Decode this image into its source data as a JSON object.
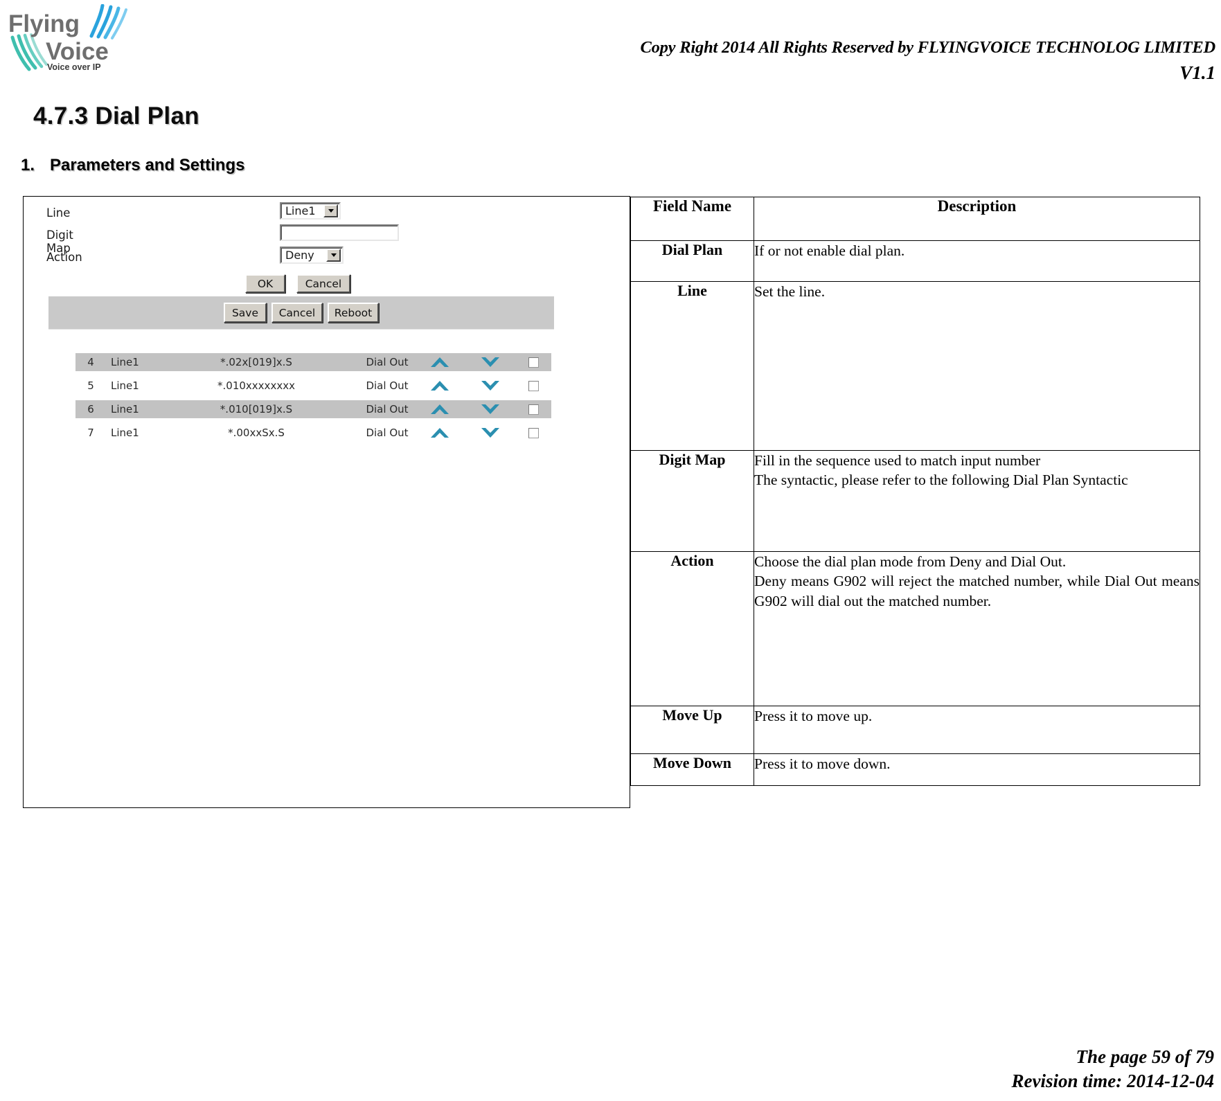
{
  "header": {
    "copyright": "Copy Right 2014 All Rights Reserved by FLYINGVOICE TECHNOLOG LIMITED",
    "version": "V1.1",
    "logo": {
      "line1": "Flying",
      "line2": "Voice",
      "tagline": "Voice over IP",
      "arc_color_blue": "#2aa3dd",
      "arc_color_teal": "#3fbfae",
      "text_color": "#6e6e6e"
    }
  },
  "headings": {
    "section": "4.7.3 Dial Plan",
    "subsection_number": "1.",
    "subsection_title": "Parameters and Settings"
  },
  "router_ui": {
    "fields": {
      "line_label": "Line",
      "line_value": "Line1",
      "digitmap_label": "Digit Map",
      "digitmap_value": "",
      "digitmap_placeholder": "",
      "action_label": "Action",
      "action_value": "Deny"
    },
    "form_buttons": {
      "ok": "OK",
      "cancel": "Cancel"
    },
    "action_bar": {
      "save": "Save",
      "cancel": "Cancel",
      "reboot": "Reboot"
    },
    "list_rows": [
      {
        "index": "4",
        "line": "Line1",
        "digits": "*.02x[019]x.S",
        "action": "Dial Out",
        "selected": true,
        "checked": false
      },
      {
        "index": "5",
        "line": "Line1",
        "digits": "*.010xxxxxxxx",
        "action": "Dial Out",
        "selected": false,
        "checked": false
      },
      {
        "index": "6",
        "line": "Line1",
        "digits": "*.010[019]x.S",
        "action": "Dial Out",
        "selected": true,
        "checked": false
      },
      {
        "index": "7",
        "line": "Line1",
        "digits": "*.00xxSx.S",
        "action": "Dial Out",
        "selected": false,
        "checked": false
      }
    ],
    "icons": {
      "move_up": "chevron-up-icon",
      "move_down": "chevron-down-icon",
      "select_row": "checkbox-icon"
    },
    "colors": {
      "chevron": "#2b8fb0",
      "toolbar_bg": "#c9c9c9",
      "row_selected_bg": "#c2c2c2",
      "button_face": "#d4d0c8"
    }
  },
  "spec_table": {
    "headers": {
      "field": "Field Name",
      "description": "Description"
    },
    "rows": [
      {
        "field": "Dial Plan",
        "lines": [
          "If or not enable dial plan."
        ]
      },
      {
        "field": "Line",
        "lines": [
          "Set the line."
        ]
      },
      {
        "field": "Digit Map",
        "lines": [
          "Fill in the sequence used to match input number",
          "The syntactic, please refer to the following Dial Plan Syntactic"
        ]
      },
      {
        "field": "Action",
        "lines": [
          "Choose the dial plan mode from Deny and Dial Out.",
          "Deny means G902 will reject the matched number, while Dial Out means G902 will dial out the matched number."
        ]
      },
      {
        "field": "Move Up",
        "lines": [
          "Press it to move up."
        ]
      },
      {
        "field": "Move Down",
        "lines": [
          "Press it to move down."
        ]
      }
    ]
  },
  "footer": {
    "page": "The page 59 of 79",
    "revision": "Revision time: 2014-12-04"
  }
}
